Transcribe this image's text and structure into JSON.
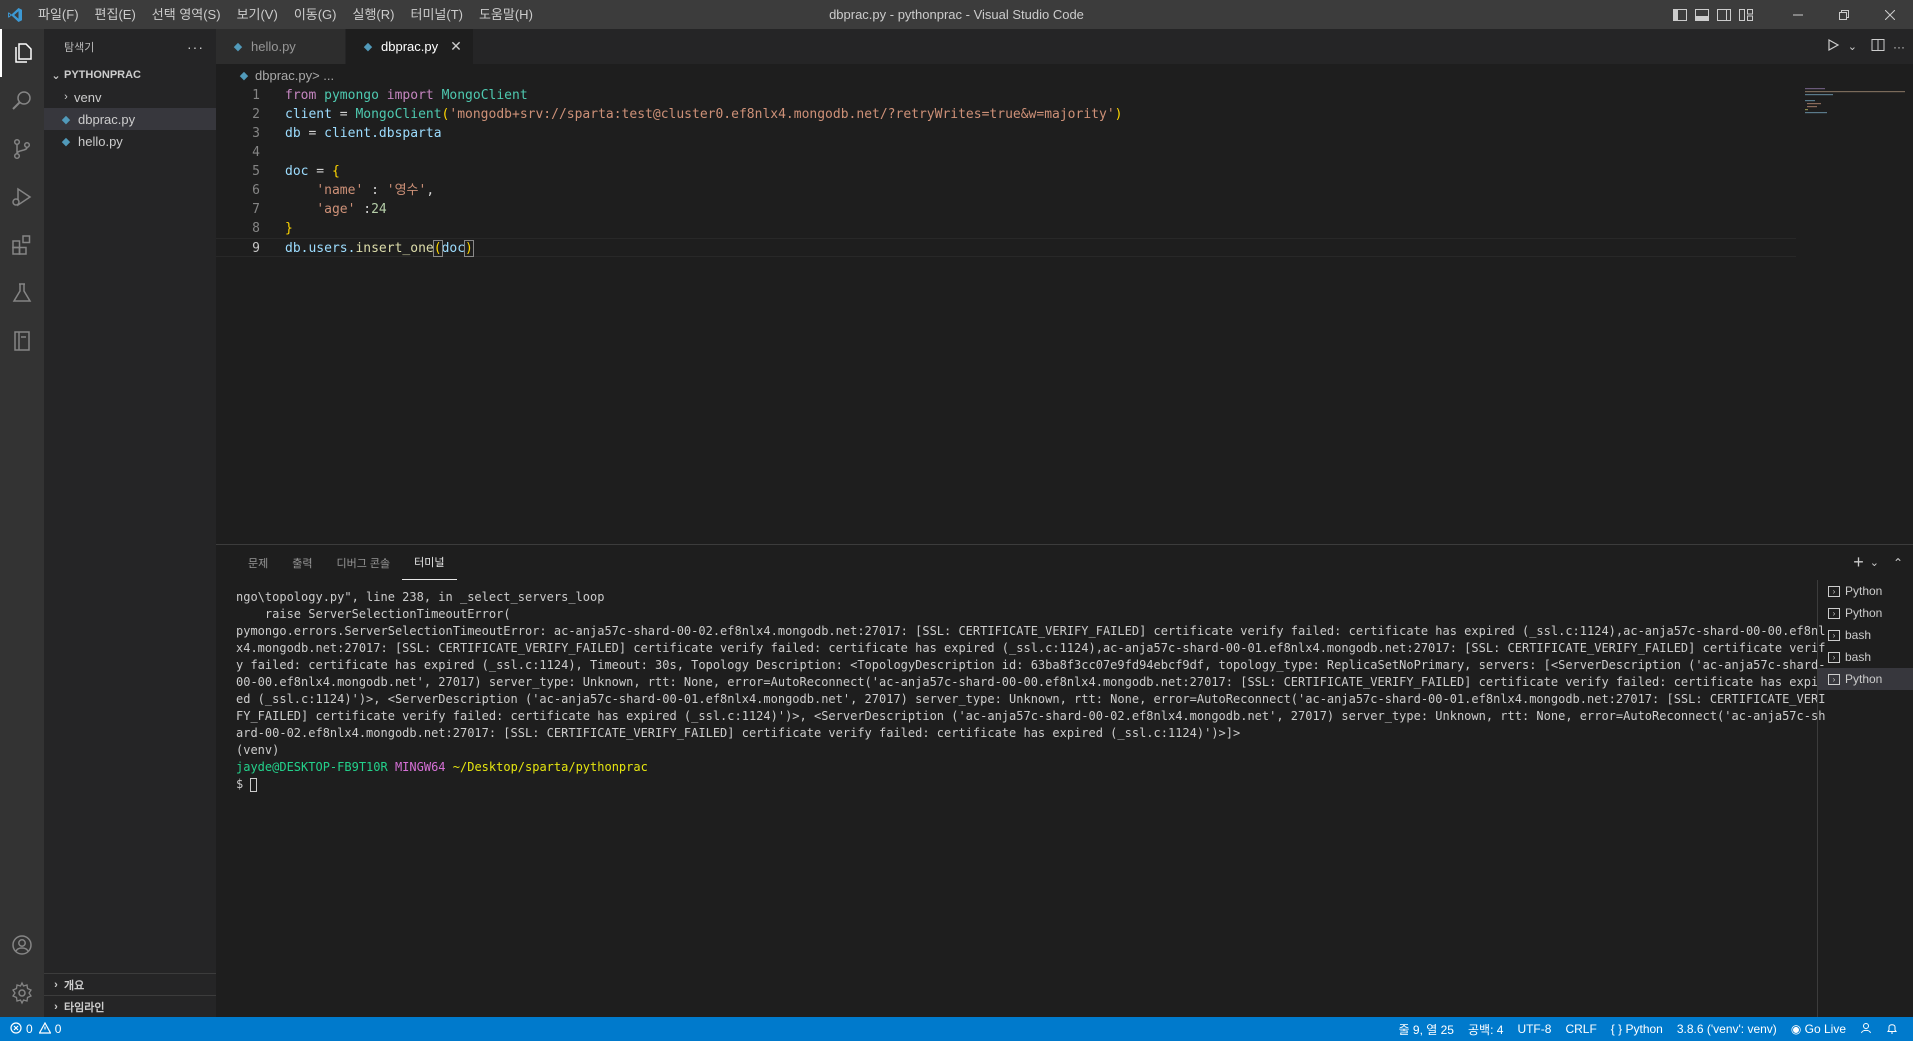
{
  "window": {
    "title": "dbprac.py - pythonprac - Visual Studio Code",
    "menu": [
      "파일(F)",
      "편집(E)",
      "선택 영역(S)",
      "보기(V)",
      "이동(G)",
      "실행(R)",
      "터미널(T)",
      "도움말(H)"
    ]
  },
  "activity_bar": {
    "items": [
      "explorer-icon",
      "search-icon",
      "source-control-icon",
      "run-debug-icon",
      "extensions-icon",
      "testing-icon",
      "notebook-icon"
    ],
    "bottom": [
      "account-icon",
      "gear-icon"
    ]
  },
  "sidebar": {
    "title": "탐색기",
    "more": "···",
    "project": "PYTHONPRAC",
    "tree": [
      {
        "label": "venv",
        "type": "folder"
      },
      {
        "label": "dbprac.py",
        "type": "file",
        "selected": true
      },
      {
        "label": "hello.py",
        "type": "file"
      }
    ],
    "bottom_sections": [
      "개요",
      "타임라인"
    ]
  },
  "editor": {
    "tabs": [
      {
        "label": "hello.py",
        "active": false
      },
      {
        "label": "dbprac.py",
        "active": true
      }
    ],
    "close_glyph": "✕",
    "breadcrumb": {
      "file": "dbprac.py",
      "rest": " > ..."
    },
    "code": {
      "l1": {
        "n": "1",
        "from": "from",
        "module": "pymongo",
        "import": "import",
        "cls": "MongoClient"
      },
      "l2": {
        "n": "2",
        "var": "client",
        "eq": " = ",
        "cls": "MongoClient",
        "open": "(",
        "str": "'mongodb+srv://sparta:test@cluster0.ef8nlx4.mongodb.net/?retryWrites=true&w=majority'",
        "close": ")"
      },
      "l3": {
        "n": "3",
        "var": "db",
        "eq": " = ",
        "rhs": "client.dbsparta"
      },
      "l4": {
        "n": "4"
      },
      "l5": {
        "n": "5",
        "var": "doc",
        "eq": " = ",
        "brace": "{"
      },
      "l6": {
        "n": "6",
        "key": "'name'",
        "sep": " : ",
        "val": "'영수'",
        "comma": ","
      },
      "l7": {
        "n": "7",
        "key": "'age'",
        "sep": " :",
        "val": "24"
      },
      "l8": {
        "n": "8",
        "brace": "}"
      },
      "l9": {
        "n": "9",
        "obj": "db.users.",
        "fn": "insert_one",
        "open": "(",
        "arg": "doc",
        "close": ")"
      }
    }
  },
  "panel": {
    "tabs": [
      {
        "label": "문제",
        "active": false
      },
      {
        "label": "출력",
        "active": false
      },
      {
        "label": "디버그 콘솔",
        "active": false
      },
      {
        "label": "터미널",
        "active": true
      }
    ],
    "actions": {
      "add": "+",
      "dropdown": "⌄",
      "maximize": "⌃"
    },
    "terminal": {
      "lines": [
        "ngo\\topology.py\", line 238, in _select_servers_loop",
        "    raise ServerSelectionTimeoutError(",
        "pymongo.errors.ServerSelectionTimeoutError: ac-anja57c-shard-00-02.ef8nlx4.mongodb.net:27017: [SSL: CERTIFICATE_VERIFY_FAILED] certificate verify failed: certificate has expired (_ssl.c:1124),ac-anja57c-shard-00-00.ef8nlx4.mongodb.net:27017: [SSL: CERTIFICATE_VERIFY_FAILED] certificate verify failed: certificate has expired (_ssl.c:1124),ac-anja57c-shard-00-01.ef8nlx4.mongodb.net:27017: [SSL: CERTIFICATE_VERIFY_FAILED] certificate verify failed: certificate has expired (_ssl.c:1124), Timeout: 30s, Topology Description: <TopologyDescription id: 63ba8f3cc07e9fd94ebcf9df, topology_type: ReplicaSetNoPrimary, servers: [<ServerDescription ('ac-anja57c-shard-00-00.ef8nlx4.mongodb.net', 27017) server_type: Unknown, rtt: None, error=AutoReconnect('ac-anja57c-shard-00-00.ef8nlx4.mongodb.net:27017: [SSL: CERTIFICATE_VERIFY_FAILED] certificate verify failed: certificate has expired (_ssl.c:1124)')>, <ServerDescription ('ac-anja57c-shard-00-01.ef8nlx4.mongodb.net', 27017) server_type: Unknown, rtt: None, error=AutoReconnect('ac-anja57c-shard-00-01.ef8nlx4.mongodb.net:27017: [SSL: CERTIFICATE_VERIFY_FAILED] certificate verify failed: certificate has expired (_ssl.c:1124)')>, <ServerDescription ('ac-anja57c-shard-00-02.ef8nlx4.mongodb.net', 27017) server_type: Unknown, rtt: None, error=AutoReconnect('ac-anja57c-shard-00-02.ef8nlx4.mongodb.net:27017: [SSL: CERTIFICATE_VERIFY_FAILED] certificate verify failed: certificate has expired (_ssl.c:1124)')>]>",
        "(venv)"
      ],
      "prompt_user": "jayde@DESKTOP-FB9T10R",
      "prompt_env": "MINGW64",
      "prompt_path": "~/Desktop/sparta/pythonprac",
      "prompt_symbol": "$"
    },
    "terminal_list": [
      {
        "label": "Python",
        "active": false
      },
      {
        "label": "Python",
        "active": false
      },
      {
        "label": "bash",
        "active": false
      },
      {
        "label": "bash",
        "active": false
      },
      {
        "label": "Python",
        "active": true
      }
    ]
  },
  "statusbar": {
    "errors": "0",
    "warnings": "0",
    "position": "줄 9, 열 25",
    "indent": "공백: 4",
    "encoding": "UTF-8",
    "eol": "CRLF",
    "language": "Python",
    "interpreter": "3.8.6 ('venv': venv)",
    "golive": "Go Live",
    "colors": {
      "background": "#007acc"
    }
  }
}
